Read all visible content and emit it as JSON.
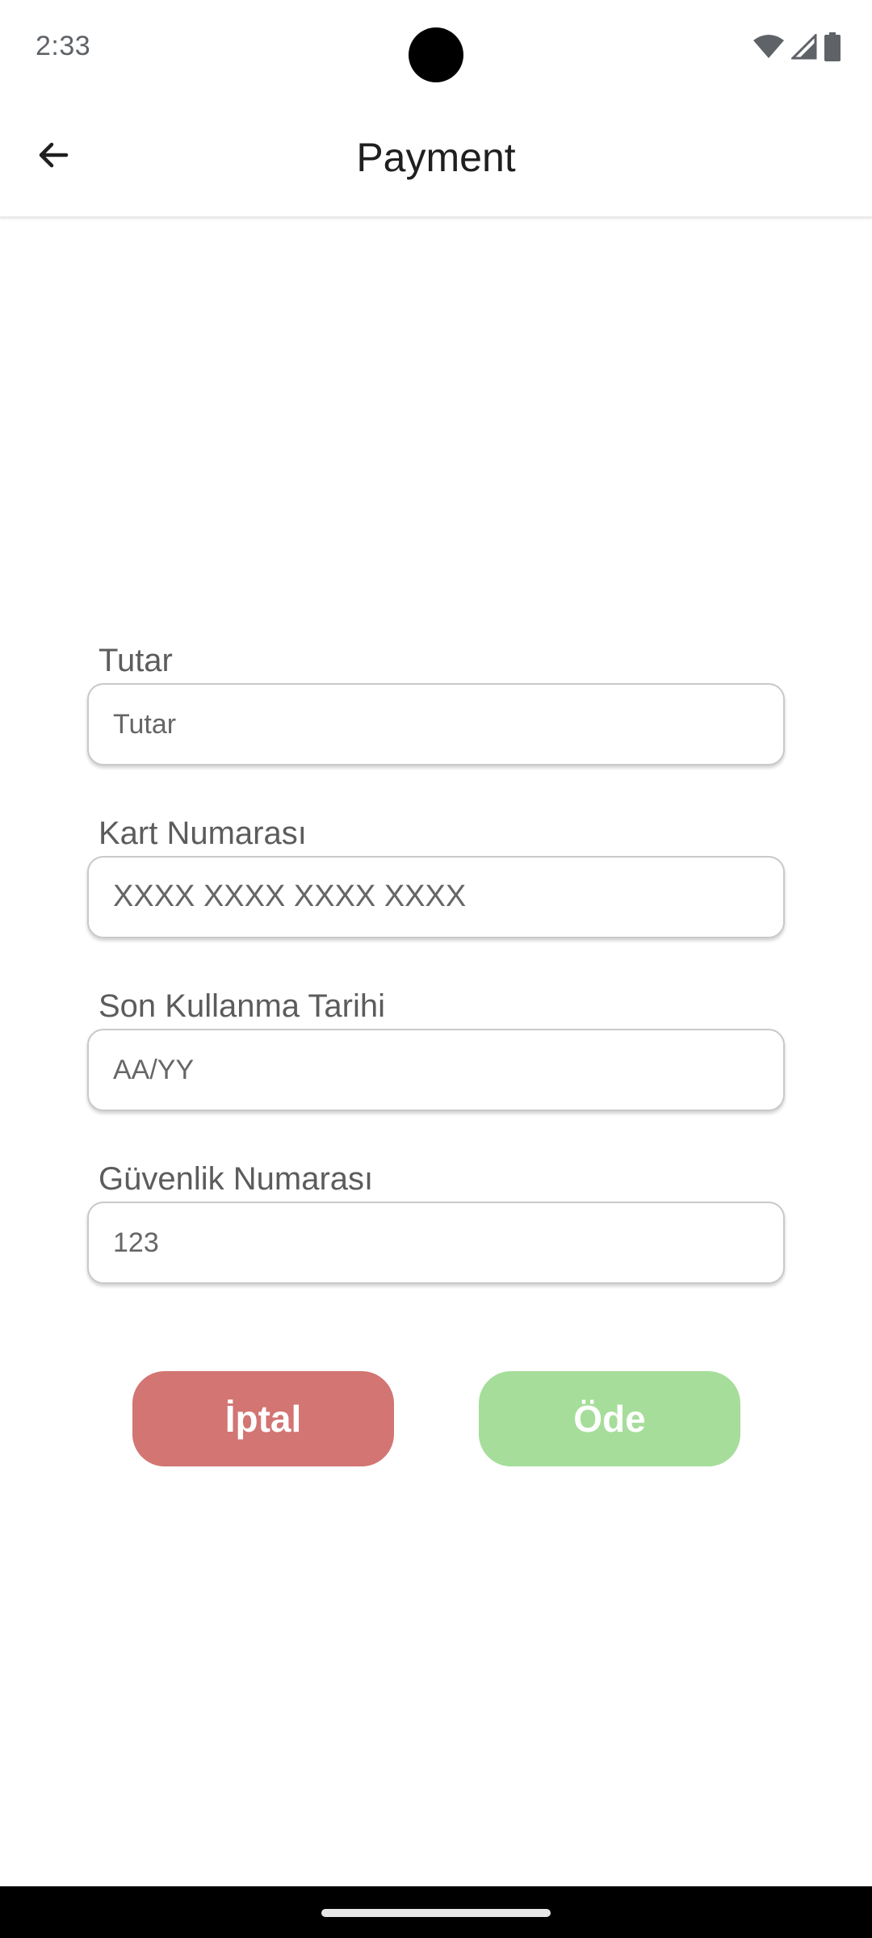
{
  "status_bar": {
    "time": "2:33",
    "icons": [
      "wifi-icon",
      "cellular-signal-icon",
      "battery-icon"
    ]
  },
  "app_bar": {
    "title": "Payment",
    "back_icon": "arrow-back-icon"
  },
  "form": {
    "amount": {
      "label": "Tutar",
      "placeholder": "Tutar",
      "value": ""
    },
    "card_number": {
      "label": "Kart Numarası",
      "placeholder": "XXXX XXXX XXXX XXXX",
      "value": ""
    },
    "expiry": {
      "label": "Son Kullanma Tarihi",
      "placeholder": "AA/YY",
      "value": ""
    },
    "cvv": {
      "label": "Güvenlik Numarası",
      "placeholder": "123",
      "value": ""
    }
  },
  "actions": {
    "cancel_label": "İptal",
    "pay_label": "Öde"
  },
  "colors": {
    "cancel": "#d27573",
    "pay": "#a6dd9b",
    "title_text": "#1f1f1f",
    "label_text": "#5c5c5c"
  }
}
